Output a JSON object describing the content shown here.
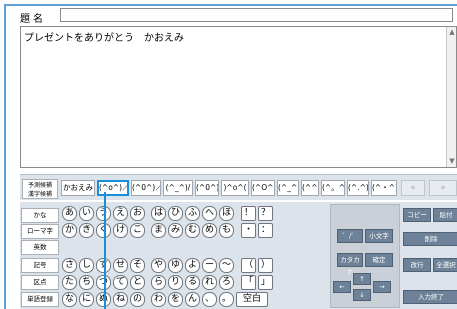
{
  "title_label": "題名",
  "title_value": "",
  "message": "プレゼントをありがとう　かおえみ",
  "suggestions": {
    "mode_label_1": "予測候補",
    "mode_label_2": "漢字候補",
    "items": [
      "かおえみ",
      "(^o^)／",
      "(^0^)／",
      "(^_^)/",
      "(^0^)",
      ")^o^(",
      "(^O^)",
      "(^_^)",
      "(^^)",
      "(^。^)",
      "(^.^)",
      "(^・^)"
    ],
    "selected_index": 1,
    "prev_label": "«",
    "next_label": "»"
  },
  "keyboard": {
    "side": [
      "かな",
      "ローマ字",
      "英数",
      "記号",
      "区点",
      "単語登録"
    ],
    "rows": [
      [
        "あ",
        "い",
        "う",
        "え",
        "お",
        "は",
        "ひ",
        "ふ",
        "へ",
        "ほ",
        "！",
        "？"
      ],
      [
        "か",
        "き",
        "く",
        "け",
        "こ",
        "ま",
        "み",
        "む",
        "め",
        "も",
        "・",
        "："
      ],
      [
        "さ",
        "し",
        "す",
        "せ",
        "そ",
        "や",
        "ゆ",
        "よ",
        "ー",
        "～",
        "（",
        "）"
      ],
      [
        "た",
        "ち",
        "つ",
        "て",
        "と",
        "ら",
        "り",
        "る",
        "れ",
        "ろ",
        "「",
        "」"
      ],
      [
        "な",
        "に",
        "ぬ",
        "ね",
        "の",
        "わ",
        "を",
        "ん",
        "、",
        "。",
        "空白"
      ]
    ],
    "panel": {
      "dakuten": "゛/゜",
      "small": "小文字",
      "katakana": "カタカナ",
      "confirm": "確定",
      "up": "↑",
      "left": "←",
      "right": "→",
      "down": "↓"
    },
    "right_col": {
      "copy": "コピー",
      "paste": "貼付",
      "delete": "削除",
      "newline": "改行",
      "select_all": "全選択",
      "finish": "入力終了"
    }
  }
}
